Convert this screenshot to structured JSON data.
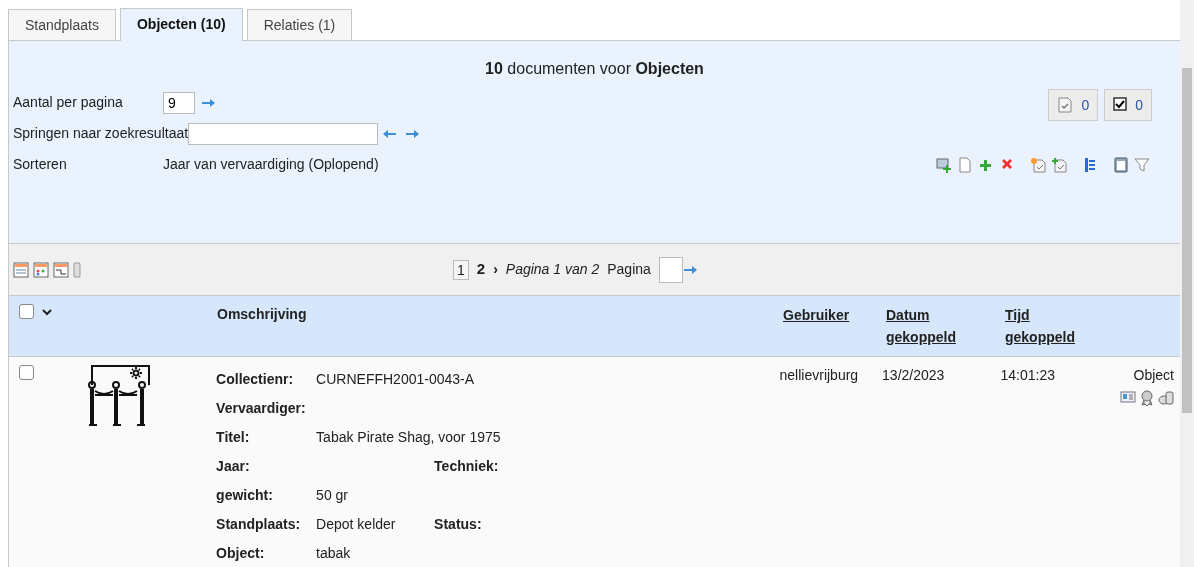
{
  "tabs": [
    {
      "label": "Standplaats",
      "selected": false
    },
    {
      "label": "Objecten (10)",
      "selected": true
    },
    {
      "label": "Relaties (1)",
      "selected": false
    }
  ],
  "search_panel": {
    "heading": "**10** documenten voor **Objecten**",
    "per_page": {
      "label": "Aantal per pagina",
      "value": "9"
    },
    "jump": {
      "label": "Springen naar zoekresultaat"
    },
    "sort": {
      "label": "Sorteren",
      "value": "Jaar van vervaardiging (Oplopend)"
    },
    "counters": [
      "0",
      "0"
    ]
  },
  "pager": {
    "pages": [
      {
        "label": "1",
        "selected": true
      },
      {
        "label": "2",
        "selected": false
      }
    ],
    "next": "›",
    "info": "Pagina 1 van 2",
    "goto_label": "Pagina"
  },
  "table": {
    "select_all": {
      "checked": false
    },
    "columns": [
      {
        "lines": [
          "Omschrijving"
        ],
        "sortable": false
      },
      {
        "lines": [
          "Gebruiker"
        ],
        "sortable": true
      },
      {
        "lines": [
          "Datum",
          "gekoppeld"
        ],
        "sortable": true
      },
      {
        "lines": [
          "Tijd",
          "gekoppeld"
        ],
        "sortable": true
      }
    ],
    "rows": [
      {
        "checked": false,
        "fields": [
          [
            {
              "label": "Collectienr:",
              "value": "CURNEFFH2001-0043-A"
            }
          ],
          [
            {
              "label": "Vervaardiger:"
            }
          ],
          [
            {
              "label": "Titel:",
              "value": "Tabak Pirate Shag, voor 1975"
            }
          ],
          [
            {
              "label": "Jaar:"
            },
            {
              "label": "Techniek:"
            }
          ],
          [
            {
              "label": "gewicht:",
              "value": "50 gr"
            }
          ],
          [
            {
              "label": "Standplaats:",
              "value": "Depot kelder"
            },
            {
              "label": "Status:"
            }
          ],
          [
            {
              "label": "Object:",
              "value": "tabak"
            }
          ]
        ],
        "user": "nellievrijburg",
        "date": "13/2/2023",
        "time": "14:01:23",
        "type": "Object"
      }
    ]
  }
}
